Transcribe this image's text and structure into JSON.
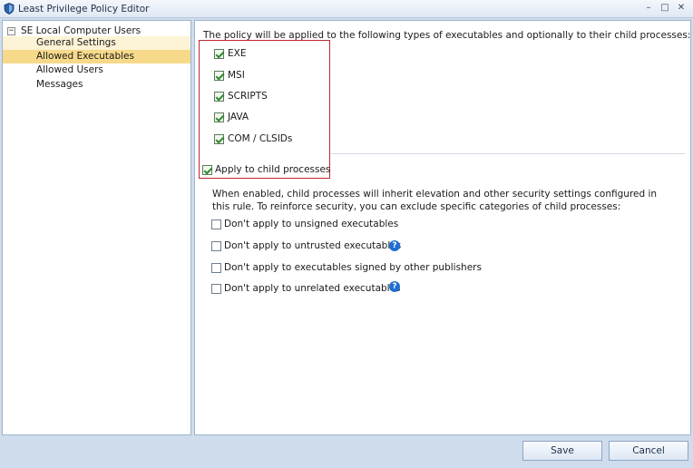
{
  "window": {
    "title": "Least Privilege Policy Editor",
    "minimize": "–",
    "maximize": "□",
    "close": "✕"
  },
  "sidebar": {
    "root_expander": "−",
    "root_label": "SE Local Computer Users",
    "items": [
      {
        "label": "General Settings"
      },
      {
        "label": "Allowed Executables",
        "selected": true
      },
      {
        "label": "Allowed Users"
      },
      {
        "label": "Messages"
      }
    ]
  },
  "main": {
    "intro": "The policy will be applied to the following types of executables and optionally to their child processes:",
    "executable_types": [
      {
        "label": "EXE",
        "checked": true
      },
      {
        "label": "MSI",
        "checked": true
      },
      {
        "label": "SCRIPTS",
        "checked": true
      },
      {
        "label": "JAVA",
        "checked": true
      },
      {
        "label": "COM / CLSIDs",
        "checked": true
      }
    ],
    "apply_child": {
      "label": "Apply to child processes",
      "checked": true
    },
    "description": "When enabled, child processes will inherit elevation and other security settings configured in this rule. To reinforce security, you can exclude specific categories of child processes:",
    "exclusions": [
      {
        "label": "Don't apply to unsigned executables",
        "checked": false,
        "help": false
      },
      {
        "label": "Don't apply to untrusted executables",
        "checked": false,
        "help": true
      },
      {
        "label": "Don't apply to executables signed by other publishers",
        "checked": false,
        "help": false
      },
      {
        "label": "Don't apply to unrelated executables",
        "checked": false,
        "help": true
      }
    ],
    "help_glyph": "?"
  },
  "footer": {
    "save_label": "Save",
    "cancel_label": "Cancel"
  },
  "colors": {
    "selected_item": "#f7d98a",
    "highlight_box": "#c0262c",
    "help_icon": "#1f6fd1"
  }
}
